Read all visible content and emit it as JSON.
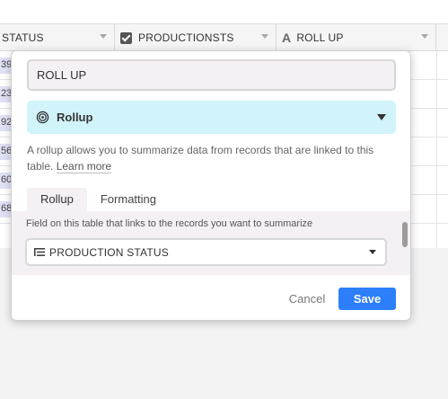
{
  "grid": {
    "columns": [
      {
        "name": "STATUS",
        "icon": "none"
      },
      {
        "name": "PRODUCTIONSTS",
        "icon": "checkbox-icon"
      },
      {
        "name": "ROLL UP",
        "icon": "text-a-icon"
      }
    ],
    "row_fragments": [
      "39",
      "23",
      "92",
      "56",
      "60",
      "68"
    ]
  },
  "dialog": {
    "field_name": "ROLL UP",
    "field_type": {
      "label": "Rollup",
      "icon": "rollup-spiral-icon"
    },
    "description": "A rollup allows you to summarize data from records that are linked to this table.",
    "learn_more": "Learn more",
    "tabs": [
      {
        "label": "Rollup",
        "active": true
      },
      {
        "label": "Formatting",
        "active": false
      }
    ],
    "linked_field_label": "Field on this table that links to the records you want to summarize",
    "linked_field_value": "PRODUCTION STATUS",
    "cancel_label": "Cancel",
    "save_label": "Save"
  },
  "colors": {
    "accent": "#2d7ff9",
    "type_select_bg": "#d1f3fa",
    "input_bg": "#f4f0f4",
    "chip_bg": "#dfe1f5"
  }
}
